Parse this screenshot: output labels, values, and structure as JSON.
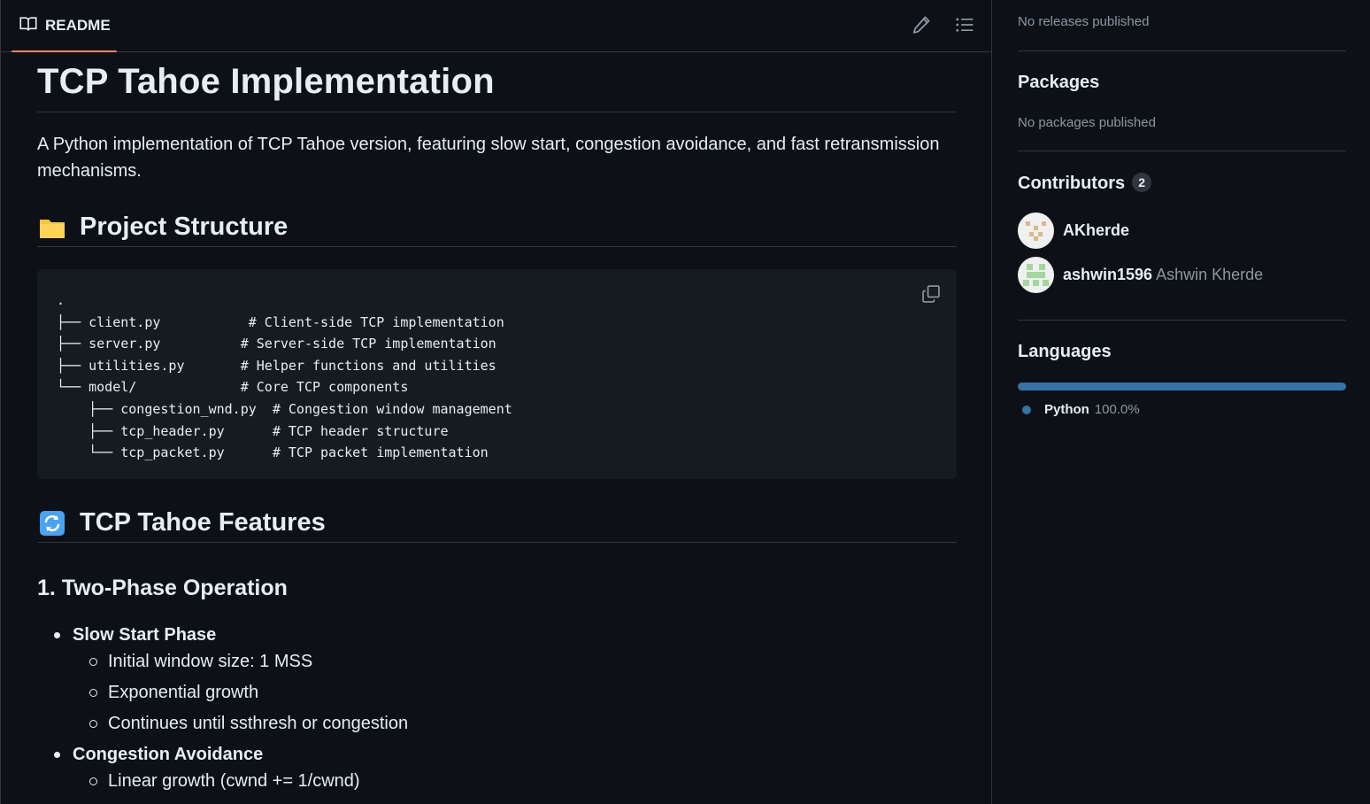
{
  "readme": {
    "tab_label": "README",
    "icons": {
      "tab": "book-icon",
      "edit": "pencil-icon",
      "toc": "list-icon",
      "copy": "copy-icon"
    },
    "title": "TCP Tahoe Implementation",
    "intro": "A Python implementation of TCP Tahoe version, featuring slow start, congestion avoidance, and fast retransmission mechanisms.",
    "structure_heading": "Project Structure",
    "structure_icon": "folder-icon",
    "code": ".\n├── client.py           # Client-side TCP implementation\n├── server.py          # Server-side TCP implementation\n├── utilities.py       # Helper functions and utilities\n└── model/             # Core TCP components\n    ├── congestion_wnd.py  # Congestion window management\n    ├── tcp_header.py      # TCP header structure\n    └── tcp_packet.py      # TCP packet implementation",
    "features_heading": "TCP Tahoe Features",
    "features_icon": "refresh-icon",
    "phase_heading": "1. Two-Phase Operation",
    "phases": [
      {
        "label": "Slow Start Phase",
        "items": [
          "Initial window size: 1 MSS",
          "Exponential growth",
          "Continues until ssthresh or congestion"
        ]
      },
      {
        "label": "Congestion Avoidance",
        "items": [
          "Linear growth (cwnd += 1/cwnd)"
        ]
      }
    ]
  },
  "sidebar": {
    "releases_text": "No releases published",
    "packages_heading": "Packages",
    "packages_text": "No packages published",
    "contributors_heading": "Contributors",
    "contributors_count": "2",
    "contributors": [
      {
        "login": "AKherde",
        "name": ""
      },
      {
        "login": "ashwin1596",
        "name": "Ashwin Kherde"
      }
    ],
    "languages_heading": "Languages",
    "languages": [
      {
        "name": "Python",
        "percent": "100.0%",
        "share": 1.0,
        "color": "#3572a5"
      }
    ]
  },
  "colors": {
    "background": "#0d1117",
    "border": "#30363d",
    "accent_tab": "#f78166",
    "code_bg": "#161b22",
    "python": "#3572a5"
  }
}
